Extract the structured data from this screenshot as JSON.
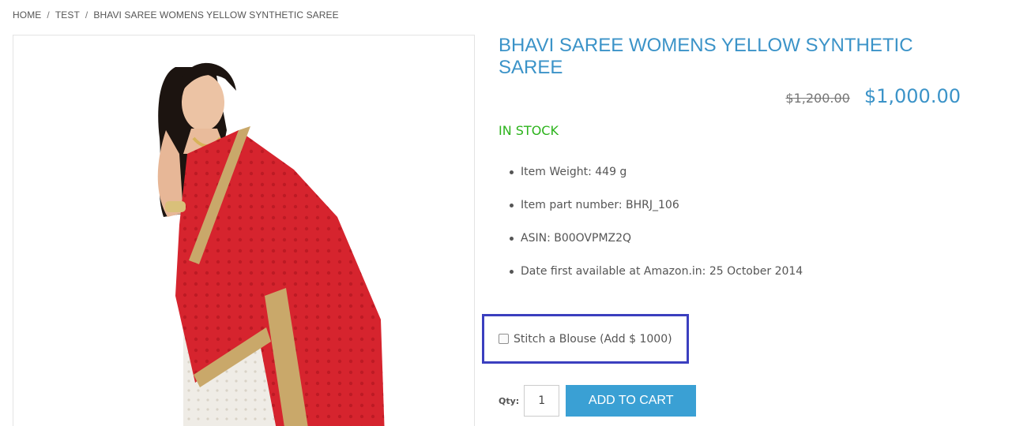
{
  "breadcrumb": {
    "home": "HOME",
    "category": "TEST",
    "current": "BHAVI SAREE WOMENS YELLOW SYNTHETIC SAREE",
    "separator": "/"
  },
  "product": {
    "title": "BHAVI SAREE WOMENS YELLOW SYNTHETIC SAREE",
    "old_price": "$1,200.00",
    "price": "$1,000.00",
    "stock": "IN STOCK",
    "attributes": [
      "Item Weight: 449 g",
      "Item part number: BHRJ_106",
      "ASIN: B00OVPMZ2Q",
      "Date first available at Amazon.in: 25 October 2014"
    ]
  },
  "options": {
    "blouse_label": "Stitch a Blouse (Add $ 1000)",
    "blouse_checked": false
  },
  "cart": {
    "qty_label": "Qty:",
    "qty_value": "1",
    "add_label": "ADD TO CART"
  },
  "colors": {
    "accent": "#3b93c8",
    "button": "#3aa0d4",
    "stock": "#2cb31c",
    "highlight_border": "#3b3fbf",
    "saree_red": "#d6242e",
    "saree_border": "#c9a86a"
  }
}
